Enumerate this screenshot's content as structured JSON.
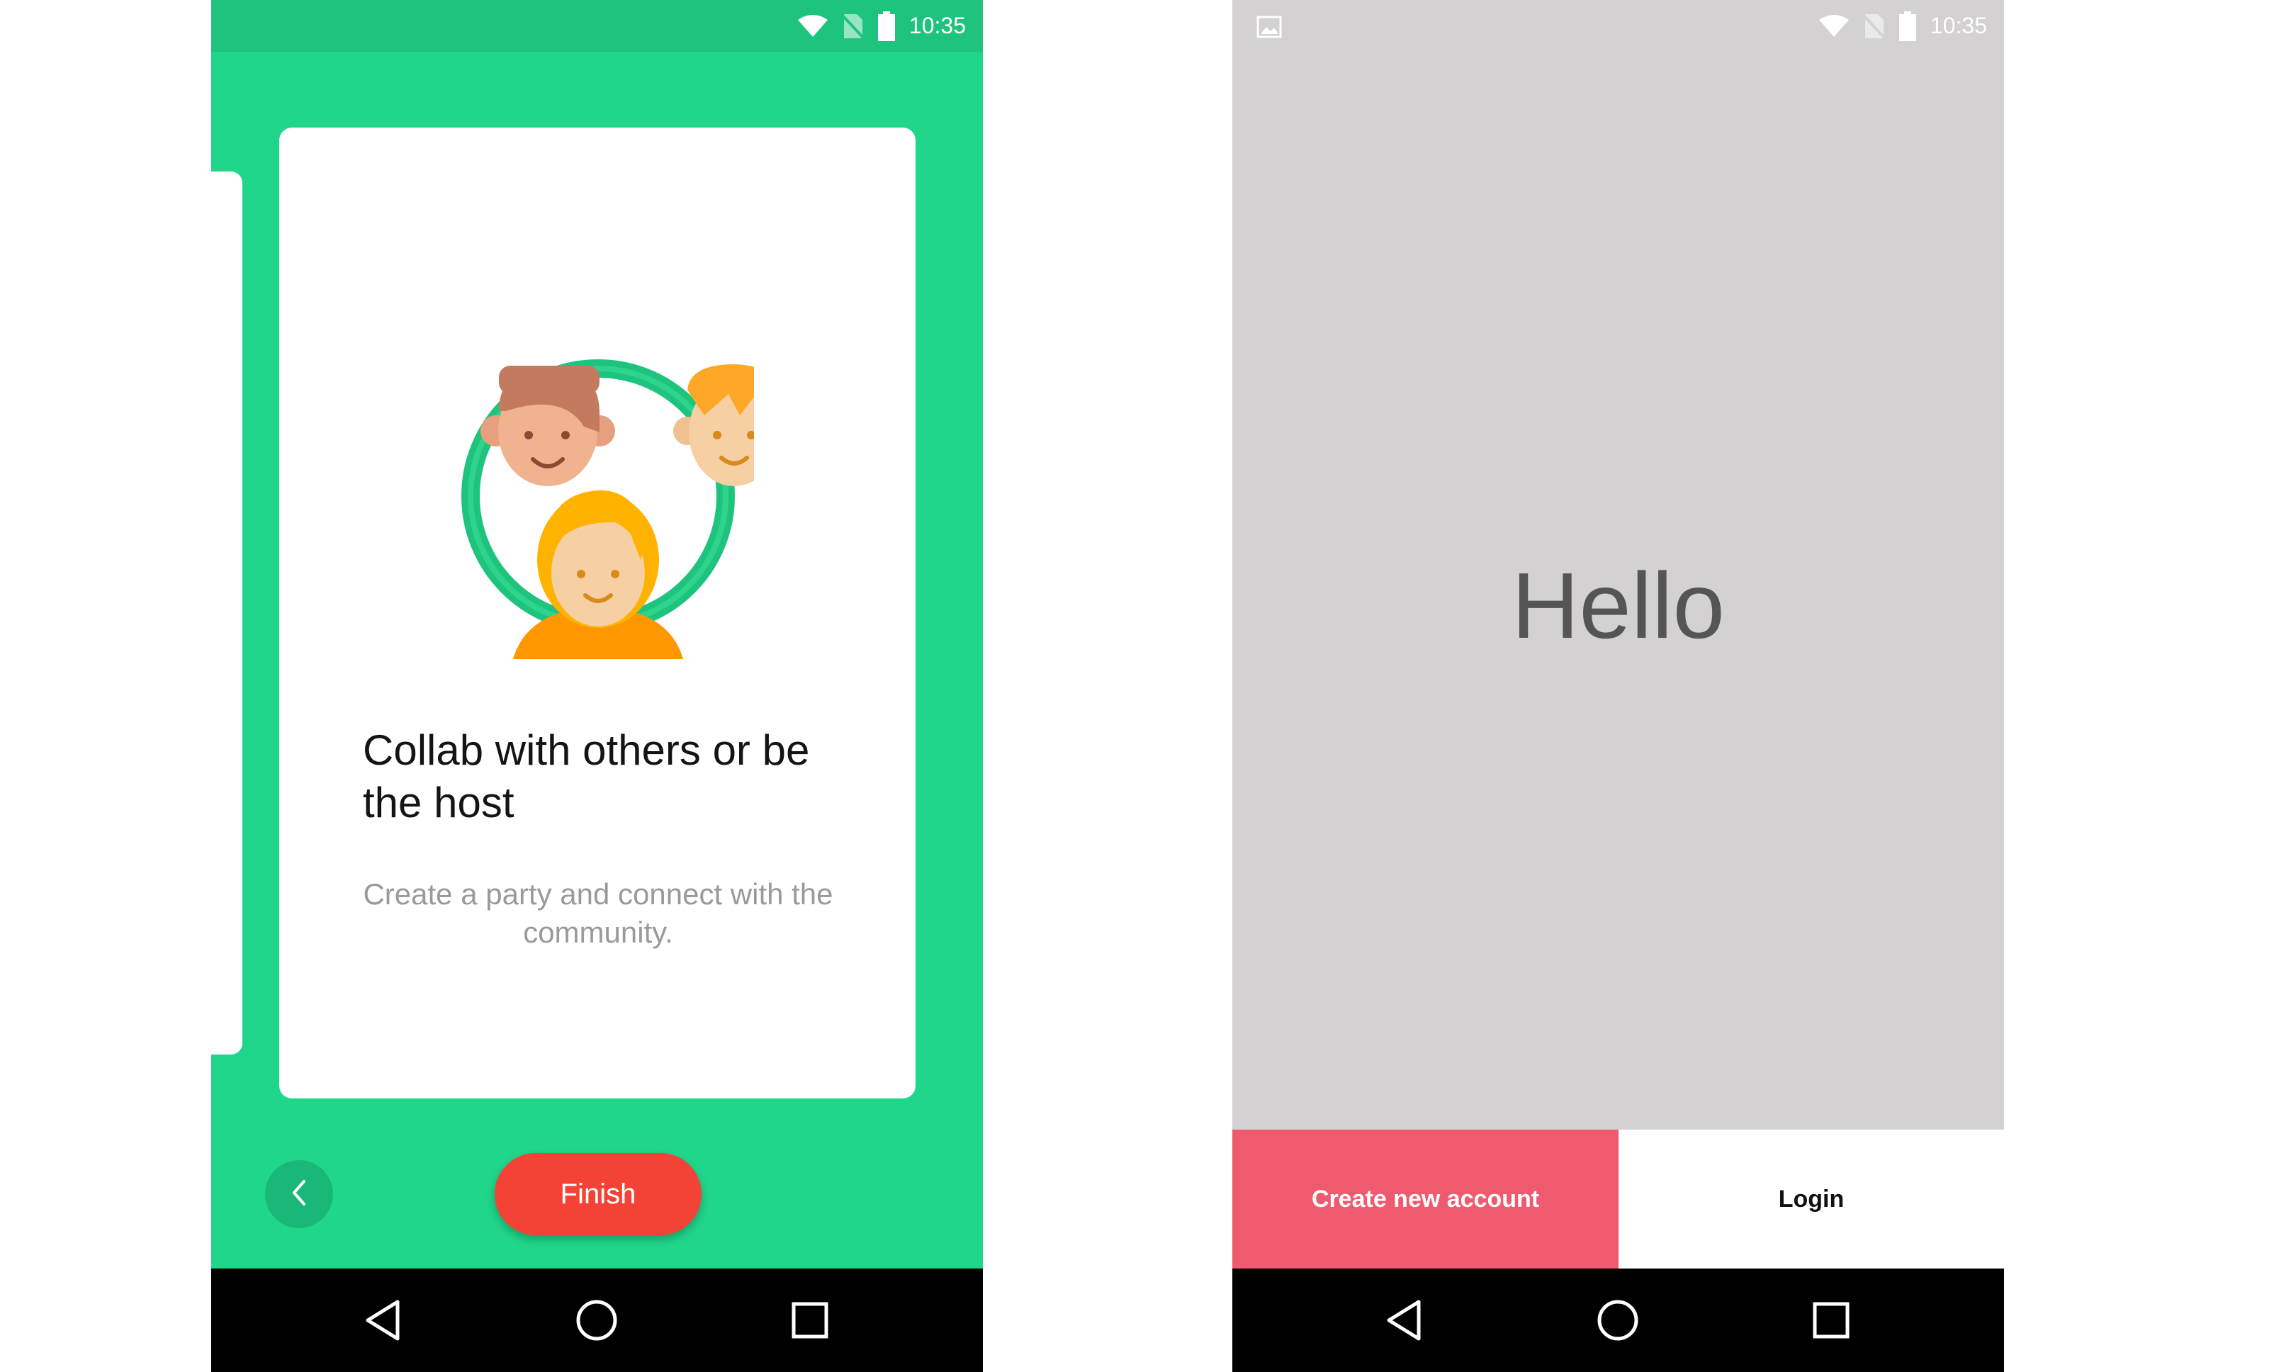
{
  "colors": {
    "onboarding_green": "#20d68a",
    "finish_red": "#f44336",
    "create_account_pink": "#ef5a6f",
    "welcome_grey": "#d3d1d2"
  },
  "phone1": {
    "status": {
      "time": "10:35",
      "icons": [
        "wifi-icon",
        "no-sim-icon",
        "battery-icon"
      ]
    },
    "card": {
      "title": "Collab with others or be the host",
      "description": "Create a party and connect with the community."
    },
    "back_icon": "chevron-left-icon",
    "finish_label": "Finish",
    "nav": [
      "back-icon",
      "home-icon",
      "recents-icon"
    ]
  },
  "phone2": {
    "status": {
      "time": "10:35",
      "icons": [
        "gallery-notification-icon",
        "wifi-icon",
        "no-sim-icon",
        "battery-icon"
      ]
    },
    "greeting": "Hello",
    "create_account_label": "Create new account",
    "login_label": "Login",
    "nav": [
      "back-icon",
      "home-icon",
      "recents-icon"
    ]
  }
}
